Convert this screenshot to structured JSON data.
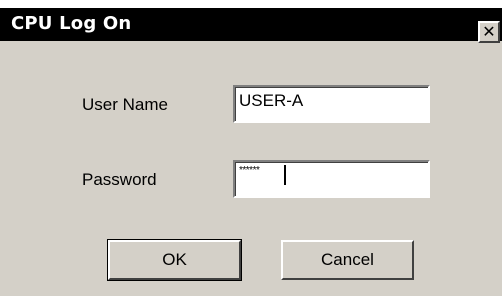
{
  "window": {
    "title": "CPU Log On",
    "close_glyph": "✕"
  },
  "form": {
    "username_label": "User Name",
    "username_value": "USER-A",
    "password_label": "Password",
    "password_value": "******"
  },
  "buttons": {
    "ok_label": "OK",
    "cancel_label": "Cancel"
  }
}
